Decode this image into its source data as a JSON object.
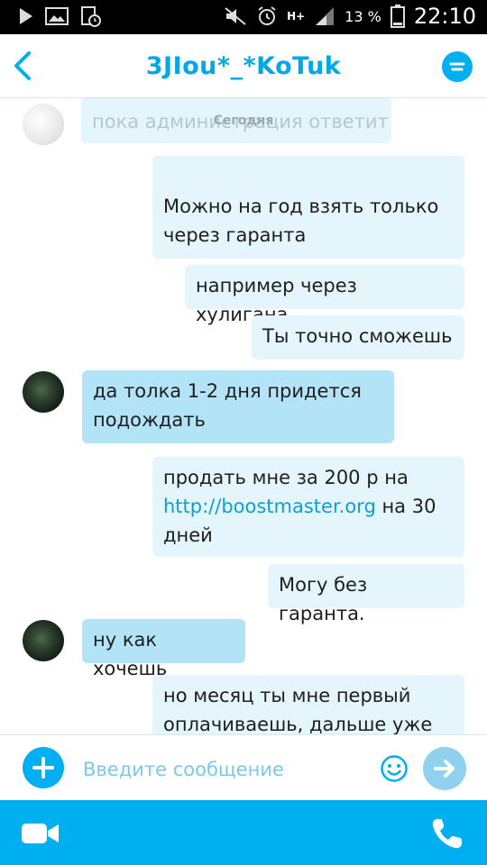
{
  "status_bar": {
    "battery_percent": "13 %",
    "time": "22:10",
    "network_label": "H+"
  },
  "header": {
    "title": "3JIou*_*KoTuk"
  },
  "chat": {
    "ghost_text": "пока администрация ответит",
    "date_label": "Сегодня",
    "messages": [
      {
        "direction": "out",
        "text": "Можно на год взять только через гаранта"
      },
      {
        "direction": "out",
        "text": "например через хулигана"
      },
      {
        "direction": "out",
        "text": "Ты точно сможешь"
      },
      {
        "direction": "in",
        "text": "да толка 1-2 дня придется подождать"
      },
      {
        "direction": "out",
        "text_before": "продать мне за 200 р на ",
        "link": "http://boostmaster.org",
        "text_after": " на 30 дней"
      },
      {
        "direction": "out",
        "text": "Могу без гаранта."
      },
      {
        "direction": "in",
        "text": "ну как хочешь"
      },
      {
        "direction": "out",
        "text": "но месяц ты мне первый оплачиваешь, дальше уже"
      }
    ]
  },
  "composer": {
    "placeholder": "Введите сообщение"
  },
  "colors": {
    "accent": "#00aff0",
    "bubble_out": "#e4f5fc",
    "bubble_in": "#b3e3f7",
    "title": "#00a8e8"
  },
  "icons": [
    "back-arrow-icon",
    "menu-icon",
    "plus-icon",
    "emoji-icon",
    "send-arrow-icon",
    "video-call-icon",
    "phone-call-icon"
  ]
}
